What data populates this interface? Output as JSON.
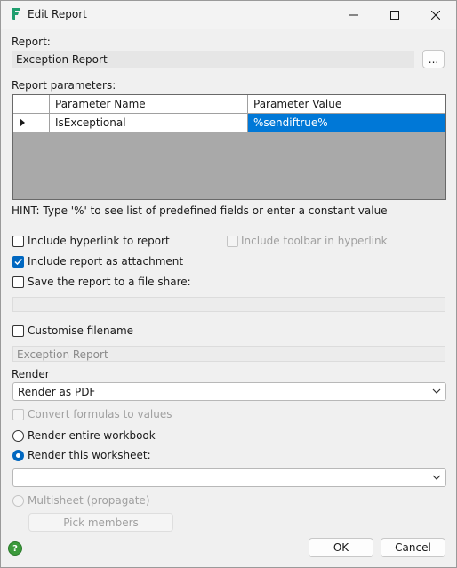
{
  "window": {
    "title": "Edit Report"
  },
  "report": {
    "label": "Report:",
    "value": "Exception Report",
    "browse_label": "..."
  },
  "parameters": {
    "label": "Report parameters:",
    "columns": [
      "Parameter Name",
      "Parameter Value"
    ],
    "rows": [
      {
        "name": "IsExceptional",
        "value": "%sendiftrue%"
      }
    ]
  },
  "hint": "HINT: Type '%' to see list of predefined fields or enter a constant value",
  "options": {
    "include_hyperlink": {
      "label": "Include hyperlink to report",
      "checked": false
    },
    "include_toolbar": {
      "label": "Include toolbar in hyperlink",
      "checked": false,
      "enabled": false
    },
    "include_attachment": {
      "label": "Include report as attachment",
      "checked": true
    },
    "save_to_share": {
      "label": "Save the report to a file share:",
      "checked": false
    },
    "customise_filename": {
      "label": "Customise filename",
      "checked": false
    },
    "filename_value": "Exception Report"
  },
  "render": {
    "label": "Render",
    "selected": "Render as PDF",
    "convert_formulas": {
      "label": "Convert formulas to values",
      "enabled": false
    },
    "entire_workbook": {
      "label": "Render entire workbook",
      "checked": false
    },
    "this_worksheet": {
      "label": "Render this worksheet:",
      "checked": true
    },
    "worksheet_selected": "",
    "multisheet": {
      "label": "Multisheet (propagate)",
      "enabled": false
    },
    "pick_members_label": "Pick members"
  },
  "footer": {
    "ok_label": "OK",
    "cancel_label": "Cancel"
  },
  "colors": {
    "accent": "#0067c0",
    "selection": "#0078d7",
    "grid_bg": "#a9a9a9",
    "logo": "#1f9e6e",
    "help": "#3c9a3c"
  }
}
